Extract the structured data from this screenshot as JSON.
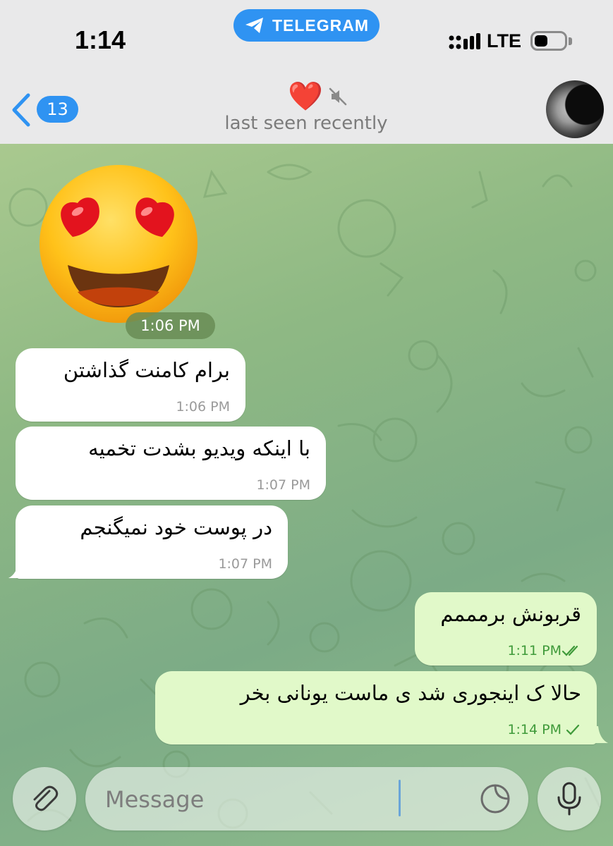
{
  "status_bar": {
    "time": "1:14",
    "app_pill_label": "TELEGRAM",
    "network": "LTE",
    "battery_level": 0.45
  },
  "header": {
    "back_badge": "13",
    "title_emoji": "❤️",
    "muted_icon": "muted-speaker-icon",
    "subtitle": "last seen recently"
  },
  "sticker": {
    "emoji": "smiling-face-with-heart-eyes",
    "time": "1:06 PM"
  },
  "messages": [
    {
      "direction": "in",
      "text": "برام کامنت گذاشتن",
      "time": "1:06 PM"
    },
    {
      "direction": "in",
      "text": "با اینکه ویدیو بشدت تخمیه",
      "time": "1:07 PM"
    },
    {
      "direction": "in",
      "text": "در پوست خود نمیگنجم",
      "time": "1:07 PM"
    },
    {
      "direction": "out",
      "text": "قربونش برمممم",
      "time": "1:11 PM",
      "status": "read"
    },
    {
      "direction": "out",
      "text": "حالا ک اینجوری شد ی ماست یونانی بخر",
      "time": "1:14 PM",
      "status": "sent"
    }
  ],
  "composer": {
    "placeholder": "Message",
    "value": ""
  },
  "colors": {
    "accent": "#2f93f2",
    "outgoing_bubble": "#e1f9c9",
    "incoming_bubble": "#ffffff",
    "time_green": "#3f9a3a"
  }
}
